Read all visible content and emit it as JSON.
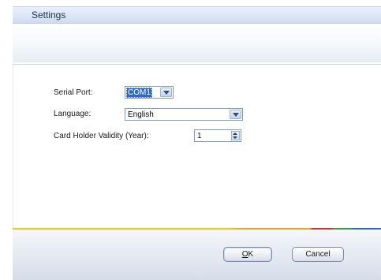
{
  "window": {
    "title": "Settings"
  },
  "form": {
    "serial_port": {
      "label": "Serial Port:",
      "value": "COM1"
    },
    "language": {
      "label": "Language:",
      "value": "English"
    },
    "validity": {
      "label": "Card Holder Validity (Year):",
      "value": "1"
    }
  },
  "buttons": {
    "ok_mnemonic": "O",
    "ok_rest": "K",
    "cancel": "Cancel"
  },
  "colors": {
    "selection": "#3169c6",
    "titlebar": "#dbe6f6",
    "stripe_yellow": "#f0c419",
    "stripe_red": "#d0342c",
    "stripe_green": "#3b9d3b",
    "stripe_blue": "#2d6cc0"
  },
  "icons": {
    "dropdown": "chevron-down-icon",
    "spinner": "up-down-arrows-icon"
  }
}
